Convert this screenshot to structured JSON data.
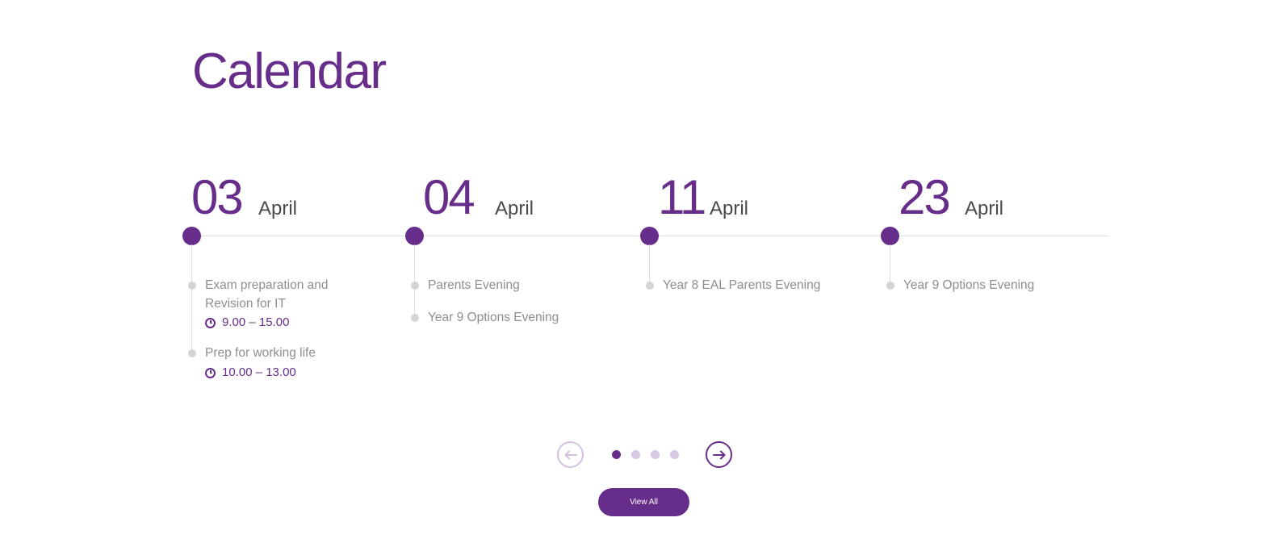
{
  "section_title": "Calendar",
  "days": [
    {
      "day": "03",
      "month": "April",
      "events": [
        {
          "title": "Exam preparation and Revision for IT",
          "time": "9.00 – 15.00"
        },
        {
          "title": "Prep for working life",
          "time": "10.00 – 13.00"
        }
      ]
    },
    {
      "day": "04",
      "month": "April",
      "events": [
        {
          "title": "Parents Evening"
        },
        {
          "title": "Year 9 Options Evening"
        }
      ]
    },
    {
      "day": "11",
      "month": "April",
      "events": [
        {
          "title": "Year 8 EAL Parents Evening"
        }
      ]
    },
    {
      "day": "23",
      "month": "April",
      "events": [
        {
          "title": "Year 9 Options Evening"
        }
      ]
    }
  ],
  "pagination": {
    "pages": 4,
    "active_page": 1
  },
  "icons": {
    "prev": "arrow-left-icon",
    "next": "arrow-right-icon",
    "time": "clock-icon"
  },
  "colors": {
    "accent": "#672d8a",
    "accent_light": "#d6c8e3",
    "text_muted": "#8e8e8e",
    "line": "#dddddd"
  },
  "view_all_label": "View All"
}
